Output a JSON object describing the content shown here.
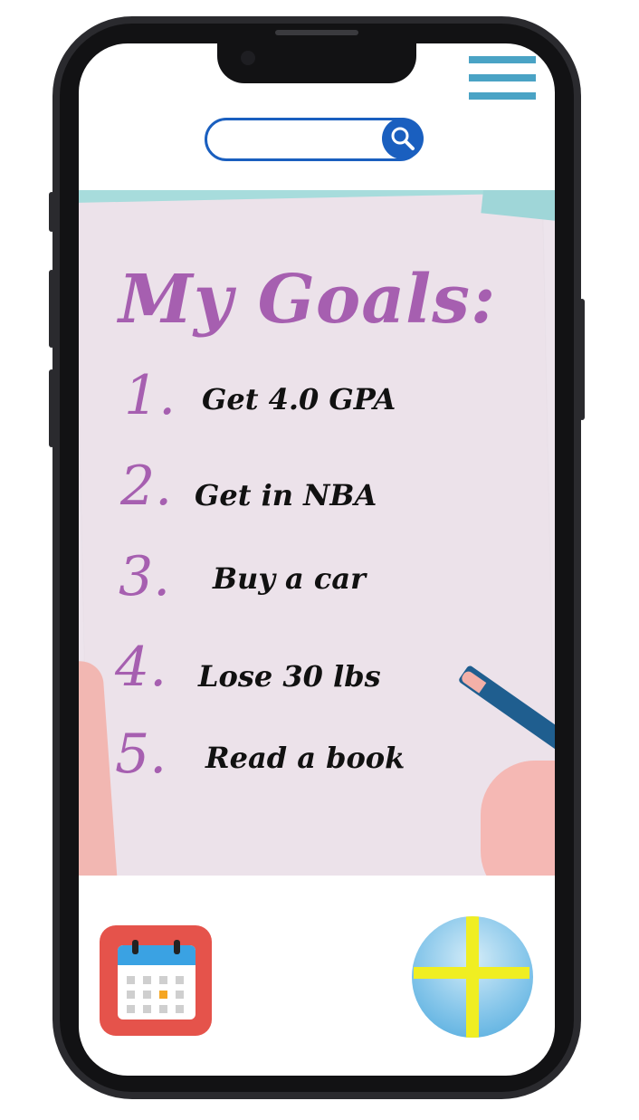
{
  "search": {
    "placeholder": "",
    "value": ""
  },
  "icons": {
    "menu": "hamburger-menu-icon",
    "search": "magnifier-icon",
    "calendar": "calendar-icon",
    "add": "plus-icon"
  },
  "note": {
    "title": "My Goals:",
    "goals": [
      {
        "number": "1.",
        "text": "Get 4.0 GPA"
      },
      {
        "number": "2.",
        "text": "Get in NBA"
      },
      {
        "number": "3.",
        "text": "Buy a car"
      },
      {
        "number": "4.",
        "text": "Lose 30 lbs"
      },
      {
        "number": "5.",
        "text": "Read a book"
      }
    ]
  },
  "colors": {
    "title_purple": "#a65fb0",
    "menu_blue": "#4aa3c5",
    "search_blue": "#1a5fbf",
    "plus_yellow": "#f0ee22",
    "calendar_red": "#e5534b"
  }
}
